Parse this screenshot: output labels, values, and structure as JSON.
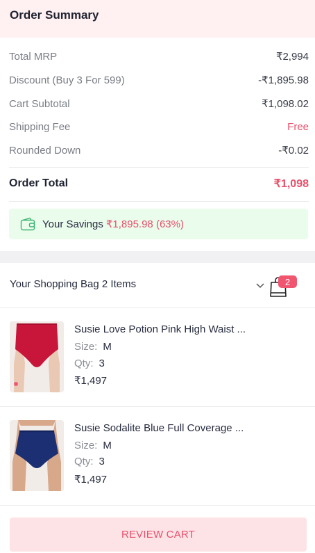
{
  "summary": {
    "title": "Order Summary",
    "rows": [
      {
        "label": "Total MRP",
        "value": "₹2,994"
      },
      {
        "label": "Discount (Buy 3 For 599)",
        "value": "-₹1,895.98"
      },
      {
        "label": "Cart Subtotal",
        "value": "₹1,098.02"
      },
      {
        "label": "Shipping Fee",
        "value": "Free"
      },
      {
        "label": "Rounded Down",
        "value": "-₹0.02"
      }
    ],
    "total_label": "Order Total",
    "total_value": "₹1,098",
    "savings_label": "Your Savings",
    "savings_value": "₹1,895.98 (63%)"
  },
  "bag": {
    "title": "Your Shopping Bag 2 Items",
    "badge_count": "2",
    "items": [
      {
        "name": "Susie Love Potion Pink High Waist ...",
        "size_label": "Size:",
        "size": "M",
        "qty_label": "Qty:",
        "qty": "3",
        "price": "₹1,497",
        "color": "#c8163b"
      },
      {
        "name": "Susie Sodalite Blue Full Coverage ...",
        "size_label": "Size:",
        "size": "M",
        "qty_label": "Qty:",
        "qty": "3",
        "price": "₹1,497",
        "color": "#1d2f73"
      }
    ]
  },
  "review_button_label": "REVIEW CART",
  "colors": {
    "accent": "#e8506b",
    "header_bg": "#fff1f2",
    "savings_bg": "#eafcec",
    "button_bg": "#fde3e6"
  }
}
